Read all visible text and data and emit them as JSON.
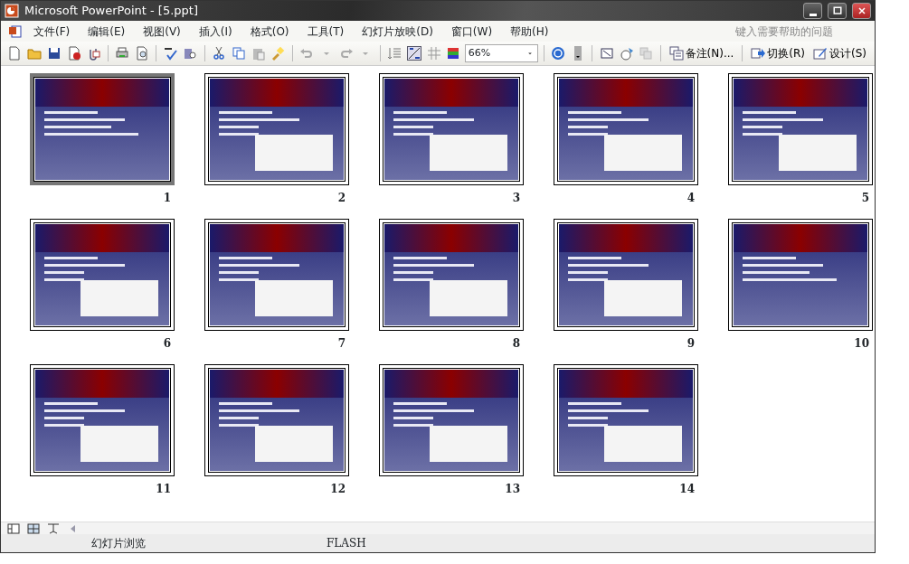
{
  "window": {
    "title": "Microsoft PowerPoint - [5.ppt]"
  },
  "menu": [
    "文件(F)",
    "编辑(E)",
    "视图(V)",
    "插入(I)",
    "格式(O)",
    "工具(T)",
    "幻灯片放映(D)",
    "窗口(W)",
    "帮助(H)"
  ],
  "help_box": {
    "placeholder": "键入需要帮助的问题"
  },
  "toolbar": {
    "zoom": "66%",
    "notes": "备注(N)...",
    "transition": "切换(R)",
    "design": "设计(S)"
  },
  "slides": [
    {
      "number": "1",
      "selected": true,
      "figure": false
    },
    {
      "number": "2",
      "selected": false,
      "figure": true
    },
    {
      "number": "3",
      "selected": false,
      "figure": true
    },
    {
      "number": "4",
      "selected": false,
      "figure": true
    },
    {
      "number": "5",
      "selected": false,
      "figure": true
    },
    {
      "number": "6",
      "selected": false,
      "figure": true
    },
    {
      "number": "7",
      "selected": false,
      "figure": true
    },
    {
      "number": "8",
      "selected": false,
      "figure": true
    },
    {
      "number": "9",
      "selected": false,
      "figure": true
    },
    {
      "number": "10",
      "selected": false,
      "figure": false
    },
    {
      "number": "11",
      "selected": false,
      "figure": true
    },
    {
      "number": "12",
      "selected": false,
      "figure": true
    },
    {
      "number": "13",
      "selected": false,
      "figure": true
    },
    {
      "number": "14",
      "selected": false,
      "figure": true
    }
  ],
  "status_bar": [
    "幻灯片浏览",
    "FLASH"
  ]
}
